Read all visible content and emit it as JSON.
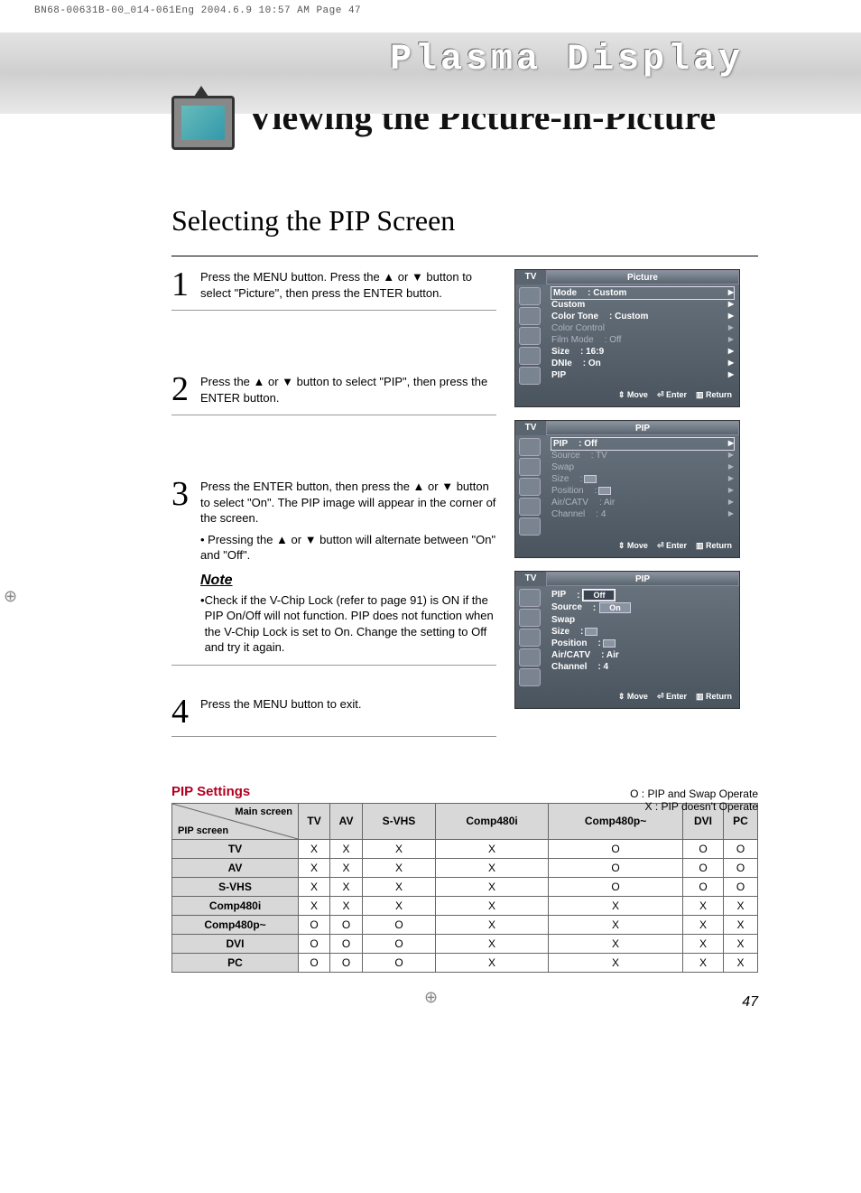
{
  "print_mark": "BN68-00631B-00_014-061Eng  2004.6.9  10:57 AM  Page 47",
  "brand": "Plasma Display",
  "main_title": "Viewing the Picture-in-Picture",
  "section_title": "Selecting the PIP Screen",
  "steps": [
    {
      "n": "1",
      "text": "Press the MENU button. Press the ▲ or ▼ button to select \"Picture\", then press the ENTER button."
    },
    {
      "n": "2",
      "text": "Press the ▲ or ▼ button to select \"PIP\", then press the ENTER button."
    },
    {
      "n": "3",
      "text": "Press the ENTER button, then press the ▲ or ▼ button to select \"On\". The PIP image will appear in the corner of the screen.",
      "bullet": "Pressing the ▲ or ▼ button will alternate between \"On\" and \"Off\".",
      "note_h": "Note",
      "note": "Check if the V-Chip Lock (refer to page 91) is ON if the PIP On/Off will not function. PIP does not function when the V-Chip Lock is set to On. Change the setting to Off and try it again."
    },
    {
      "n": "4",
      "text": "Press the MENU button to exit."
    }
  ],
  "osd": {
    "foot": {
      "move": "Move",
      "enter": "Enter",
      "return": "Return"
    },
    "panel1": {
      "tv": "TV",
      "title": "Picture",
      "rows": [
        {
          "l": "Mode",
          "v": ":  Custom",
          "sel": true
        },
        {
          "l": "Custom",
          "v": ""
        },
        {
          "l": "Color Tone",
          "v": ":  Custom"
        },
        {
          "l": "Color Control",
          "v": "",
          "dim": true
        },
        {
          "l": "Film Mode",
          "v": ":  Off",
          "dim": true
        },
        {
          "l": "Size",
          "v": ":  16:9"
        },
        {
          "l": "DNIe",
          "v": ":  On"
        },
        {
          "l": "PIP",
          "v": ""
        }
      ]
    },
    "panel2": {
      "tv": "TV",
      "title": "PIP",
      "rows": [
        {
          "l": "PIP",
          "v": ":  Off",
          "sel": true
        },
        {
          "l": "Source",
          "v": ":  TV",
          "dim": true
        },
        {
          "l": "Swap",
          "v": "",
          "dim": true
        },
        {
          "l": "Size",
          "v": ":",
          "dim": true,
          "icon": true
        },
        {
          "l": "Position",
          "v": ":",
          "dim": true,
          "icon": true
        },
        {
          "l": "Air/CATV",
          "v": ":  Air",
          "dim": true
        },
        {
          "l": "Channel",
          "v": ":  4",
          "dim": true
        }
      ]
    },
    "panel3": {
      "tv": "TV",
      "title": "PIP",
      "rows": [
        {
          "l": "PIP",
          "v": ":"
        },
        {
          "l": "Source",
          "v": ":"
        },
        {
          "l": "Swap",
          "v": ""
        },
        {
          "l": "Size",
          "v": ":",
          "icon": true
        },
        {
          "l": "Position",
          "v": ":",
          "icon": true
        },
        {
          "l": "Air/CATV",
          "v": ":  Air"
        },
        {
          "l": "Channel",
          "v": ":  4"
        }
      ],
      "opts": {
        "off": "Off",
        "on": "On"
      }
    }
  },
  "pip_settings_h": "PIP Settings",
  "legend": {
    "o": "O :  PIP and Swap Operate",
    "x": "X  :  PIP doesn't Operate"
  },
  "table": {
    "diag_top": "Main screen",
    "diag_bot": "PIP screen",
    "cols": [
      "TV",
      "AV",
      "S-VHS",
      "Comp480i",
      "Comp480p~",
      "DVI",
      "PC"
    ],
    "rows": [
      {
        "h": "TV",
        "c": [
          "X",
          "X",
          "X",
          "X",
          "O",
          "O",
          "O"
        ]
      },
      {
        "h": "AV",
        "c": [
          "X",
          "X",
          "X",
          "X",
          "O",
          "O",
          "O"
        ]
      },
      {
        "h": "S-VHS",
        "c": [
          "X",
          "X",
          "X",
          "X",
          "O",
          "O",
          "O"
        ]
      },
      {
        "h": "Comp480i",
        "c": [
          "X",
          "X",
          "X",
          "X",
          "X",
          "X",
          "X"
        ]
      },
      {
        "h": "Comp480p~",
        "c": [
          "O",
          "O",
          "O",
          "X",
          "X",
          "X",
          "X"
        ]
      },
      {
        "h": "DVI",
        "c": [
          "O",
          "O",
          "O",
          "X",
          "X",
          "X",
          "X"
        ]
      },
      {
        "h": "PC",
        "c": [
          "O",
          "O",
          "O",
          "X",
          "X",
          "X",
          "X"
        ]
      }
    ]
  },
  "page_num": "47"
}
